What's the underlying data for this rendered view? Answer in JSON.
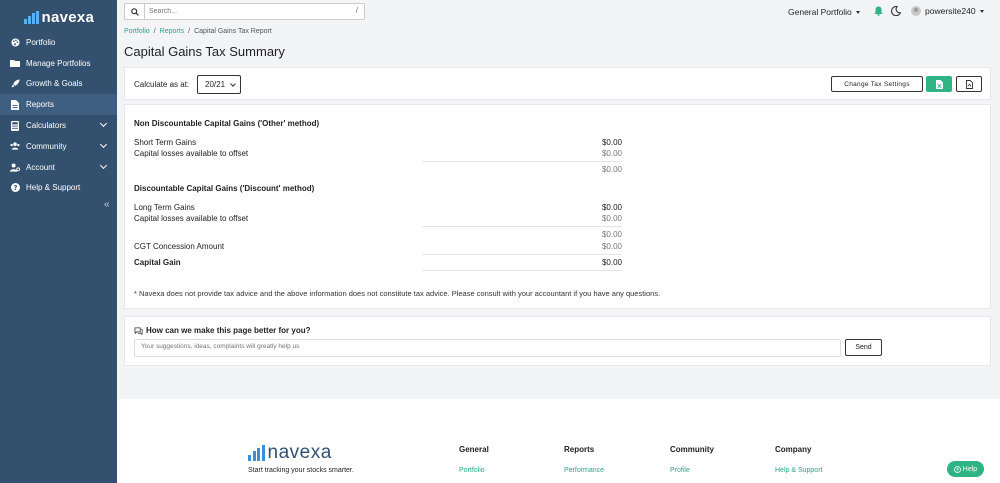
{
  "app": {
    "name": "navexa"
  },
  "sidebar": {
    "items": [
      {
        "label": "Portfolio",
        "icon": "palette-icon"
      },
      {
        "label": "Manage Portfolios",
        "icon": "folder-icon"
      },
      {
        "label": "Growth & Goals",
        "icon": "rocket-icon"
      },
      {
        "label": "Reports",
        "icon": "report-icon",
        "active": true
      },
      {
        "label": "Calculators",
        "icon": "calculator-icon"
      },
      {
        "label": "Community",
        "icon": "users-icon"
      },
      {
        "label": "Account",
        "icon": "user-cog-icon"
      },
      {
        "label": "Help & Support",
        "icon": "question-circle-icon"
      }
    ],
    "collapse_glyph": "«"
  },
  "topbar": {
    "search_placeholder": "Search...",
    "search_shortcut": "/",
    "portfolio_name": "General Portfolio",
    "username": "powersite240"
  },
  "breadcrumb": {
    "items": [
      "Portfolio",
      "Reports",
      "Capital Gains Tax Report"
    ]
  },
  "page_title": "Capital Gains Tax Summary",
  "controls": {
    "calculate_label": "Calculate as at:",
    "year_value": "20/21",
    "tax_settings_label": "Change Tax Settings"
  },
  "summary": {
    "non_discount": {
      "heading": "Non Discountable Capital Gains ('Other' method)",
      "short_term_label": "Short Term Gains",
      "short_term_value": "$0.00",
      "losses_label": "Capital losses available to offset",
      "losses_value": "$0.00",
      "subtotal": "$0.00"
    },
    "discount": {
      "heading": "Discountable Capital Gains ('Discount' method)",
      "long_term_label": "Long Term Gains",
      "long_term_value": "$0.00",
      "losses_label": "Capital losses available to offset",
      "losses_value": "$0.00",
      "subtotal": "$0.00",
      "concession_label": "CGT Concession Amount",
      "concession_value": "$0.00",
      "capital_gain_label": "Capital Gain",
      "capital_gain_value": "$0.00"
    },
    "disclaimer": "* Navexa does not provide tax advice and the above information does not constitute tax advice. Please consult with your accountant if you have any questions."
  },
  "feedback": {
    "title": "How can we make this page better for you?",
    "placeholder": "Your suggestions, ideas, complaints will greatly help us",
    "send_label": "Send"
  },
  "footer": {
    "brand": "navexa",
    "tagline": "Start tracking your stocks smarter.",
    "columns": [
      {
        "heading": "General",
        "link": "Portfolio"
      },
      {
        "heading": "Reports",
        "link": "Performance"
      },
      {
        "heading": "Community",
        "link": "Profile"
      },
      {
        "heading": "Company",
        "link": "Help & Support"
      }
    ],
    "help_label": "Help"
  },
  "colors": {
    "sidebar": "#33506e",
    "accent": "#2aa68a",
    "button_green": "#2eb382"
  }
}
